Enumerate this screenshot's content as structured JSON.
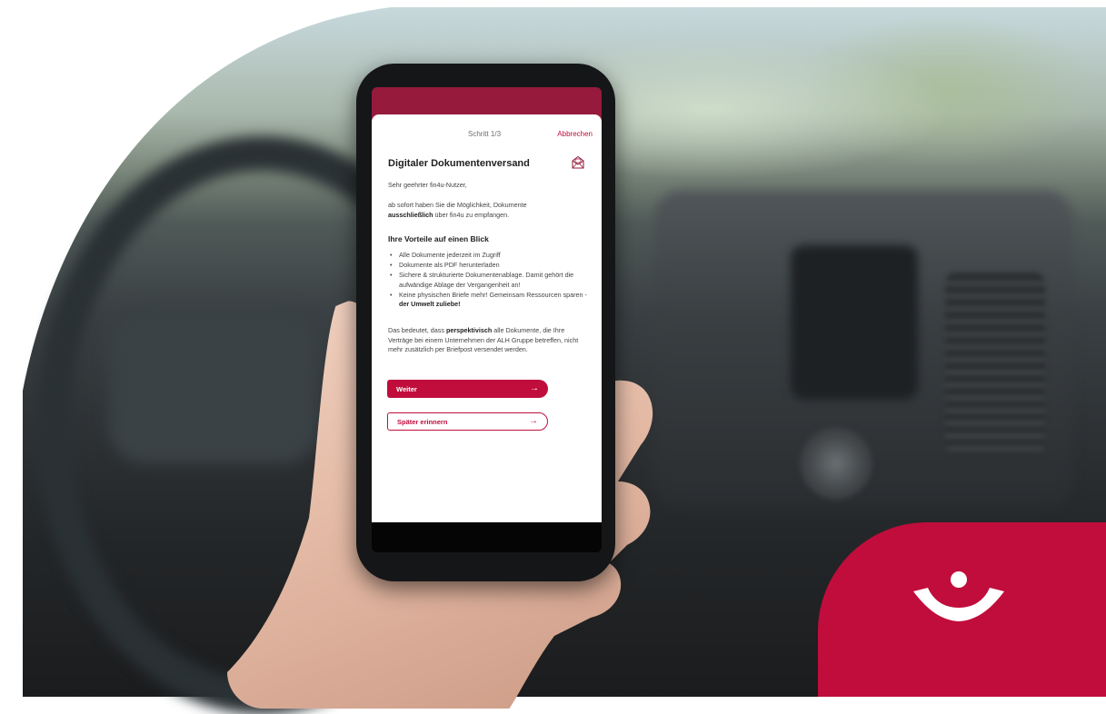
{
  "app": {
    "step_label": "Schritt 1/3",
    "cancel_label": "Abbrechen",
    "title": "Digitaler Dokumentenversand",
    "greeting": "Sehr geehrter fin4u-Nutzer,",
    "intro_prefix": "ab sofort haben Sie die Möglichkeit, Dokumente",
    "intro_bold": "ausschließlich",
    "intro_suffix": "über fin4u zu empfangen.",
    "benefits_heading": "Ihre Vorteile auf einen Blick",
    "benefits": [
      "Alle Dokumente jederzeit im Zugriff",
      "Dokumente als PDF herunterladen",
      "Sichere & strukturierte Dokumentenablage. Damit gehört die aufwändige Ablage der Vergangenheit an!"
    ],
    "benefit4_prefix": "Keine physischen Briefe mehr! Gemeinsam Ressourcen sparen -",
    "benefit4_bold": "der Umwelt zuliebe!",
    "info_prefix": "Das bedeutet, dass",
    "info_bold": "perspektivisch",
    "info_suffix": "alle Dokumente, die Ihre Verträge bei einem Unternehmen der ALH Gruppe betreffen, nicht mehr zusätzlich per Briefpost versendet werden.",
    "primary_button": "Weiter",
    "secondary_button": "Später erinnern",
    "arrow_glyph": "→"
  },
  "colors": {
    "brand": "#c00d3c",
    "header": "#961a3c"
  },
  "icons": {
    "mail": "envelope-icon",
    "logo": "brand-logo-icon"
  }
}
